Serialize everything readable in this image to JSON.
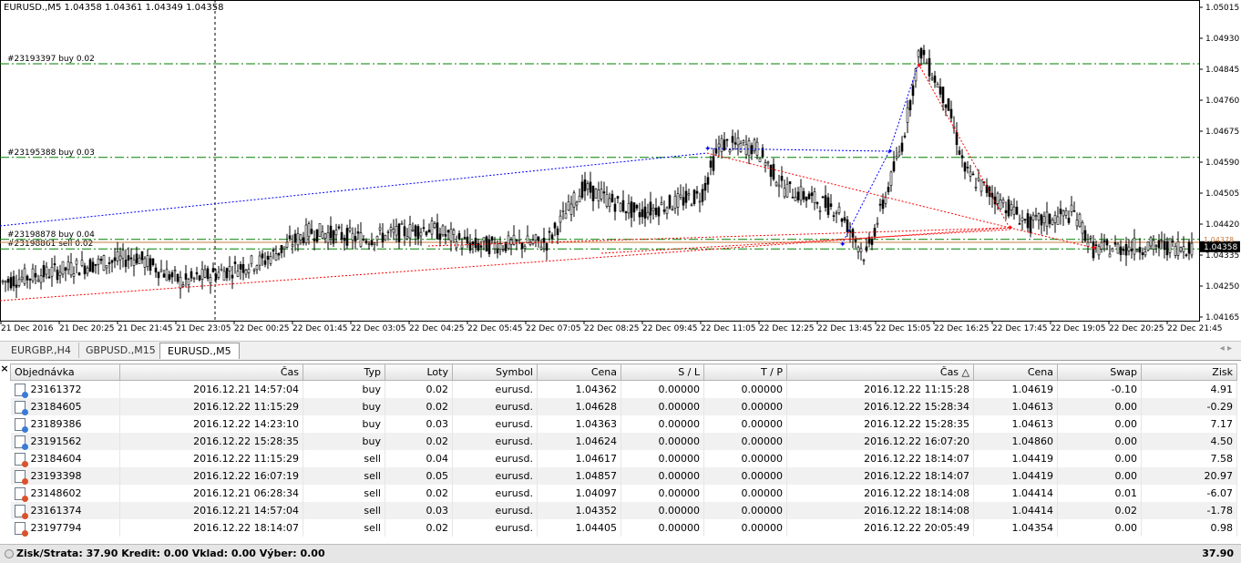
{
  "chart": {
    "symbol_info": "EURUSD.,M5  1.04358 1.04361 1.04349 1.04358",
    "price_labels": [
      "1.05015",
      "1.04930",
      "1.04845",
      "1.04760",
      "1.04675",
      "1.04590",
      "1.04505",
      "1.04420",
      "1.04335",
      "1.04250",
      "1.04165"
    ],
    "current_price": "1.04358",
    "hidden_price": "1.04378",
    "time_labels": [
      "21 Dec 2016",
      "21 Dec 20:25",
      "21 Dec 21:45",
      "21 Dec 23:05",
      "22 Dec 00:25",
      "22 Dec 01:45",
      "22 Dec 03:05",
      "22 Dec 04:25",
      "22 Dec 05:45",
      "22 Dec 07:05",
      "22 Dec 08:25",
      "22 Dec 09:45",
      "22 Dec 11:05",
      "22 Dec 12:25",
      "22 Dec 13:45",
      "22 Dec 15:05",
      "22 Dec 16:25",
      "22 Dec 17:45",
      "22 Dec 19:05",
      "22 Dec 20:25",
      "22 Dec 21:45"
    ],
    "order_lines": [
      {
        "label": "#23193397 buy 0.02"
      },
      {
        "label": "#23195388 buy 0.03"
      },
      {
        "label": "#23198878 buy 0.04"
      },
      {
        "label": "#23198861 sell 0.02"
      }
    ],
    "colors": {
      "candle": "#000000",
      "order_line": "#008000",
      "buy_path": "#0000ff",
      "sell_path": "#ff0000",
      "current_line": "#ff6600"
    }
  },
  "tabs": [
    {
      "label": "EURGBP.,H4"
    },
    {
      "label": "GBPUSD.,M15"
    },
    {
      "label": "EURUSD.,M5",
      "active": true
    }
  ],
  "tab_nav": "◂ ▸",
  "close_glyph": "×",
  "table": {
    "headers": [
      "Objednávka",
      "Čas",
      "Typ",
      "Loty",
      "Symbol",
      "Cena",
      "S / L",
      "T / P",
      "Čas  △",
      "Cena",
      "Swap",
      "Zisk"
    ],
    "rows": [
      {
        "order": "23161372",
        "open_time": "2016.12.21 14:57:04",
        "type": "buy",
        "lots": "0.02",
        "symbol": "eurusd.",
        "open_price": "1.04362",
        "sl": "0.00000",
        "tp": "0.00000",
        "close_time": "2016.12.22 11:15:28",
        "close_price": "1.04619",
        "swap": "-0.10",
        "profit": "4.91"
      },
      {
        "order": "23184605",
        "open_time": "2016.12.22 11:15:29",
        "type": "buy",
        "lots": "0.02",
        "symbol": "eurusd.",
        "open_price": "1.04628",
        "sl": "0.00000",
        "tp": "0.00000",
        "close_time": "2016.12.22 15:28:34",
        "close_price": "1.04613",
        "swap": "0.00",
        "profit": "-0.29"
      },
      {
        "order": "23189386",
        "open_time": "2016.12.22 14:23:10",
        "type": "buy",
        "lots": "0.03",
        "symbol": "eurusd.",
        "open_price": "1.04363",
        "sl": "0.00000",
        "tp": "0.00000",
        "close_time": "2016.12.22 15:28:35",
        "close_price": "1.04613",
        "swap": "0.00",
        "profit": "7.17"
      },
      {
        "order": "23191562",
        "open_time": "2016.12.22 15:28:35",
        "type": "buy",
        "lots": "0.02",
        "symbol": "eurusd.",
        "open_price": "1.04624",
        "sl": "0.00000",
        "tp": "0.00000",
        "close_time": "2016.12.22 16:07:20",
        "close_price": "1.04860",
        "swap": "0.00",
        "profit": "4.50"
      },
      {
        "order": "23184604",
        "open_time": "2016.12.22 11:15:29",
        "type": "sell",
        "lots": "0.04",
        "symbol": "eurusd.",
        "open_price": "1.04617",
        "sl": "0.00000",
        "tp": "0.00000",
        "close_time": "2016.12.22 18:14:07",
        "close_price": "1.04419",
        "swap": "0.00",
        "profit": "7.58"
      },
      {
        "order": "23193398",
        "open_time": "2016.12.22 16:07:19",
        "type": "sell",
        "lots": "0.05",
        "symbol": "eurusd.",
        "open_price": "1.04857",
        "sl": "0.00000",
        "tp": "0.00000",
        "close_time": "2016.12.22 18:14:07",
        "close_price": "1.04419",
        "swap": "0.00",
        "profit": "20.97"
      },
      {
        "order": "23148602",
        "open_time": "2016.12.21 06:28:34",
        "type": "sell",
        "lots": "0.02",
        "symbol": "eurusd.",
        "open_price": "1.04097",
        "sl": "0.00000",
        "tp": "0.00000",
        "close_time": "2016.12.22 18:14:08",
        "close_price": "1.04414",
        "swap": "0.01",
        "profit": "-6.07"
      },
      {
        "order": "23161374",
        "open_time": "2016.12.21 14:57:04",
        "type": "sell",
        "lots": "0.03",
        "symbol": "eurusd.",
        "open_price": "1.04352",
        "sl": "0.00000",
        "tp": "0.00000",
        "close_time": "2016.12.22 18:14:08",
        "close_price": "1.04414",
        "swap": "0.02",
        "profit": "-1.78"
      },
      {
        "order": "23197794",
        "open_time": "2016.12.22 18:14:07",
        "type": "sell",
        "lots": "0.02",
        "symbol": "eurusd.",
        "open_price": "1.04405",
        "sl": "0.00000",
        "tp": "0.00000",
        "close_time": "2016.12.22 20:05:49",
        "close_price": "1.04354",
        "swap": "0.00",
        "profit": "0.98"
      }
    ]
  },
  "footer": {
    "summary": "Zisk/Strata: 37.90   Kredit: 0.00   Vklad: 0.00   Výber: 0.00",
    "total": "37.90"
  }
}
